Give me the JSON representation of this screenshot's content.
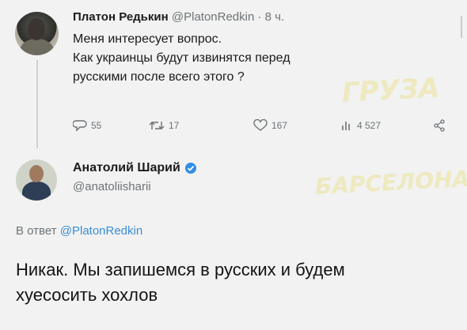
{
  "tweet": {
    "author_name": "Платон Редькин",
    "handle": "@PlatonRedkin",
    "time": "8 ч.",
    "text_lines": [
      "Меня интересует вопрос.",
      "Как украинцы будут извинятся перед",
      "русскими после всего этого ?"
    ],
    "replies": "55",
    "retweets": "17",
    "likes": "167",
    "views": "4 527"
  },
  "reply": {
    "author_name": "Анатолий Шарий",
    "handle": "@anatoliisharii",
    "reply_to_prefix": "В ответ",
    "reply_to_mention": "@PlatonRedkin",
    "text_lines": [
      "Никак. Мы запишемся в русских и будем",
      "хуесосить хохлов"
    ]
  },
  "watermark": {
    "line1": "ГРУЗА",
    "line2": "БАРСЕЛОНА"
  },
  "colors": {
    "background": "#f1f2f1",
    "secondary_text": "#6e7378",
    "accent": "#3a8dd8",
    "verified": "#2f8fe6"
  }
}
